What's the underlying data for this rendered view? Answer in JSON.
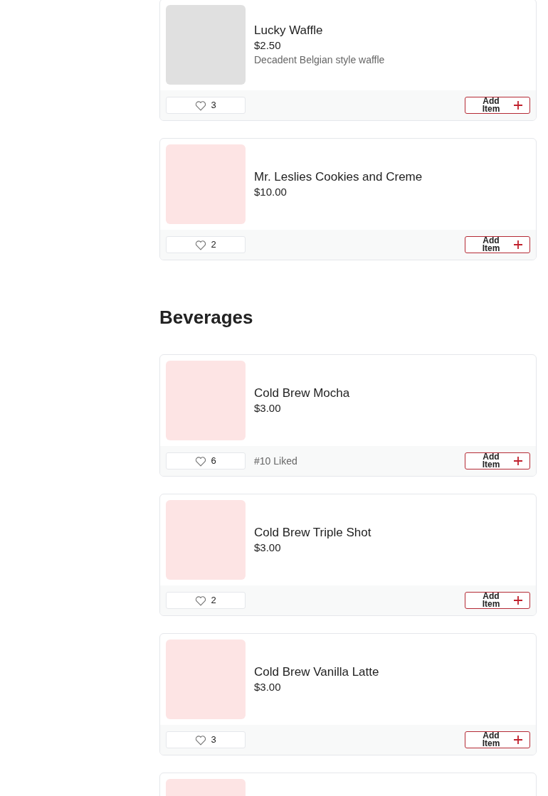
{
  "sections": [
    {
      "items": [
        {
          "name": "Lucky Waffle",
          "price": "$2.50",
          "description": "Decadent Belgian style waffle",
          "color": "#e0e0e0",
          "likes": "3",
          "button": "Add Item"
        },
        {
          "name": "Mr. Leslies Cookies and Creme",
          "price": "$10.00",
          "color": "#fde4e4",
          "likes": "2",
          "button": "Add Item"
        }
      ]
    },
    {
      "title": "Beverages",
      "items": [
        {
          "name": "Cold Brew Mocha",
          "price": "$3.00",
          "color": "#fde4e4",
          "likes": "6",
          "rank": "#10 Liked",
          "button": "Add Item"
        },
        {
          "name": "Cold Brew Triple Shot",
          "price": "$3.00",
          "color": "#fde4e4",
          "likes": "2",
          "button": "Add Item"
        },
        {
          "name": "Cold Brew Vanilla Latte",
          "price": "$3.00",
          "color": "#fde4e4",
          "likes": "3",
          "button": "Add Item"
        },
        {
          "color": "#fde4e4"
        }
      ]
    }
  ]
}
